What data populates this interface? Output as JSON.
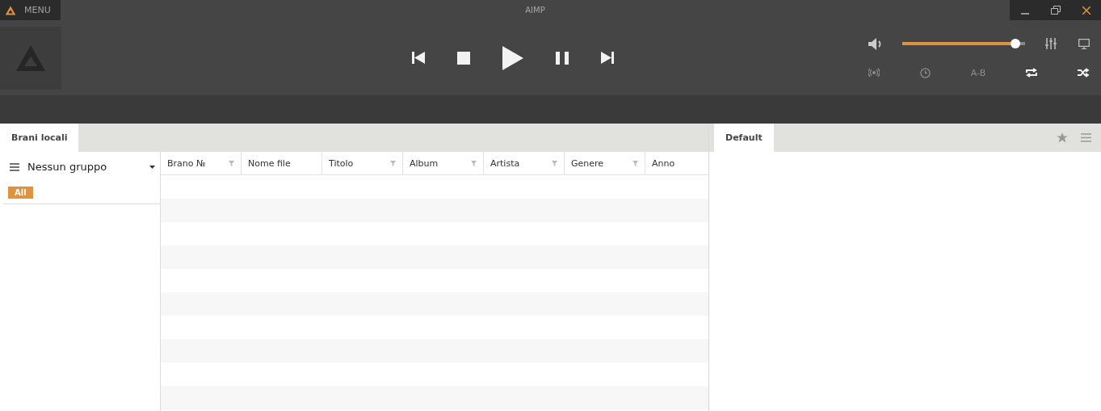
{
  "menu": {
    "label": "MENU"
  },
  "window": {
    "title": "AIMP"
  },
  "volume": {
    "level": 0.92
  },
  "toggles": [
    {
      "kind": "radio",
      "on": false
    },
    {
      "kind": "timer",
      "on": false
    },
    {
      "kind": "ab",
      "label": "A-B",
      "on": false
    },
    {
      "kind": "repeat",
      "on": true
    },
    {
      "kind": "shuffle",
      "on": true
    }
  ],
  "library": {
    "tabs": [
      {
        "label": "Brani locali",
        "selected": true
      }
    ],
    "grouping": {
      "label": "Nessun gruppo"
    },
    "filters": [
      {
        "label": "All",
        "selected": true
      }
    ],
    "table": {
      "columns": [
        {
          "label": "Brano №",
          "filter": true
        },
        {
          "label": "Nome file",
          "filter": false
        },
        {
          "label": "Titolo",
          "filter": true
        },
        {
          "label": "Album",
          "filter": true
        },
        {
          "label": "Artista",
          "filter": true
        },
        {
          "label": "Genere",
          "filter": true
        },
        {
          "label": "Anno",
          "filter": false
        }
      ]
    }
  },
  "playlists": {
    "tabs": [
      {
        "label": "Default",
        "selected": true
      }
    ]
  }
}
